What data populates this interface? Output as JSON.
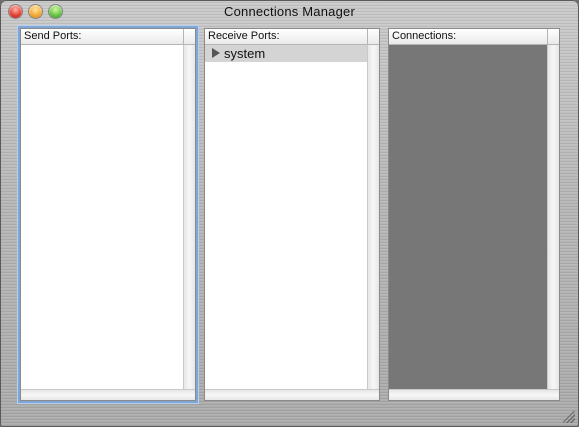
{
  "window": {
    "title": "Connections Manager"
  },
  "panels": {
    "send_ports": {
      "header": "Send Ports:",
      "items": []
    },
    "receive_ports": {
      "header": "Receive Ports:",
      "items": [
        {
          "label": "system",
          "expanded": false,
          "icon": "disclosure-triangle-right-icon"
        }
      ]
    },
    "connections": {
      "header": "Connections:",
      "canvas_color": "#777777"
    }
  },
  "colors": {
    "focus_ring": "#7fa6d9",
    "selected_row": "#d4d4d4",
    "close_button": "#e0382b",
    "minimize_button": "#f2a52b",
    "zoom_button": "#5ec23a"
  }
}
